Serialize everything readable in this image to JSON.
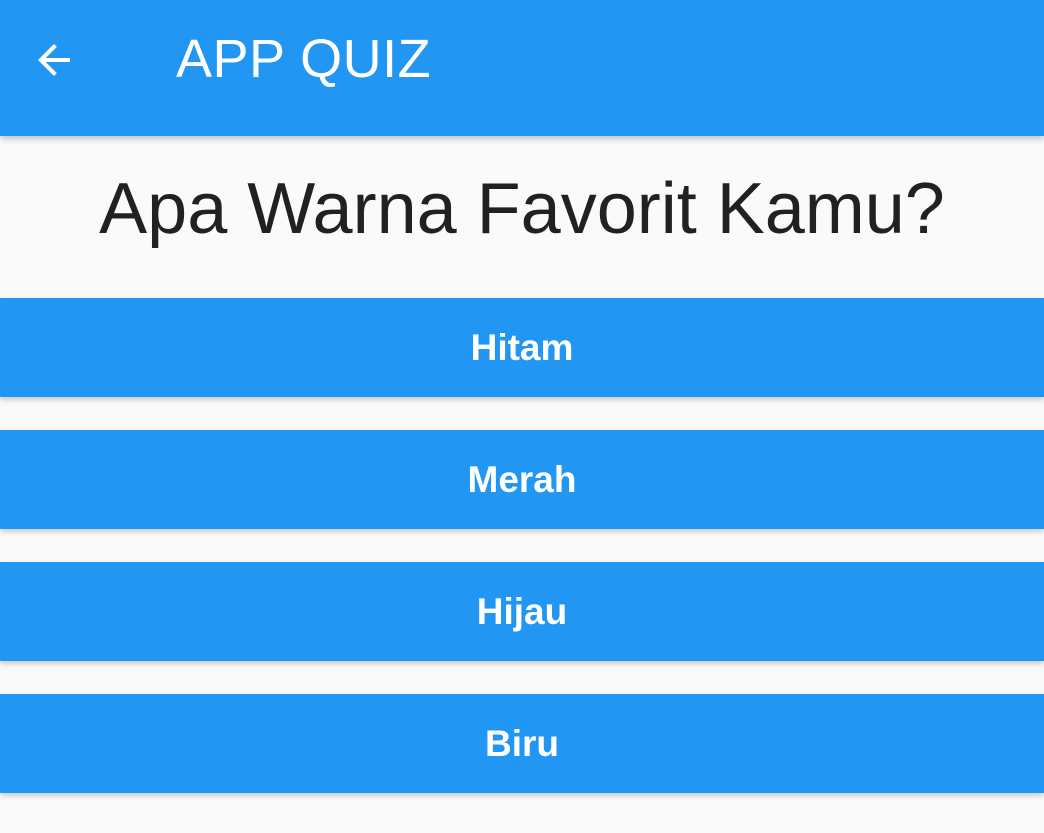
{
  "app_bar": {
    "back_icon": "arrow-left-icon",
    "title": "APP QUIZ",
    "background_color": "#2196f3",
    "text_color": "#ffffff"
  },
  "question": {
    "text": "Apa Warna Favorit Kamu?"
  },
  "answers": [
    {
      "label": "Hitam"
    },
    {
      "label": "Merah"
    },
    {
      "label": "Hijau"
    },
    {
      "label": "Biru"
    }
  ],
  "colors": {
    "primary": "#2196f3",
    "background": "#fafafa",
    "question_text": "#212121",
    "button_text": "#ffffff"
  }
}
